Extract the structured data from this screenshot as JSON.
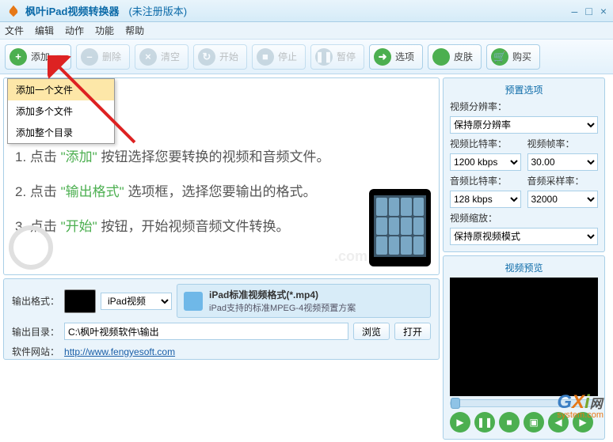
{
  "title": "枫叶iPad视频转换器",
  "subtitle": "(未注册版本)",
  "menus": [
    "文件",
    "编辑",
    "动作",
    "功能",
    "帮助"
  ],
  "toolbar": {
    "add": "添加",
    "delete": "删除",
    "clear": "清空",
    "start": "开始",
    "stop": "停止",
    "pause": "暂停",
    "options": "选项",
    "skin": "皮肤",
    "buy": "购买"
  },
  "add_menu": {
    "i1": "添加一个文件",
    "i2": "添加多个文件",
    "i3": "添加整个目录"
  },
  "instructions": {
    "l1a": "1. 点击",
    "l1b": "\"添加\"",
    "l1c": "按钮选择您要转换的视频和音频文件。",
    "l2a": "2. 点击",
    "l2b": "\"输出格式\"",
    "l2c": "选项框，选择您要输出的格式。",
    "l3a": "3. 点击",
    "l3b": "\"开始\"",
    "l3c": "按钮，开始视频音频文件转换。"
  },
  "watermark_text": ".com",
  "output": {
    "format_label": "输出格式：",
    "format_sel": "iPad视频",
    "format_title": "iPad标准视频格式(*.mp4)",
    "format_desc": "iPad支持的标准MPEG-4视频预置方案",
    "dir_label": "输出目录：",
    "dir_value": "C:\\枫叶视频软件\\输出",
    "browse": "浏览",
    "open": "打开",
    "site_label": "软件网站：",
    "site_url": "http://www.fengyesoft.com"
  },
  "preset": {
    "title": "预置选项",
    "res_label": "视频分辨率：",
    "res_value": "保持原分辨率",
    "vbit_label": "视频比特率：",
    "vbit_value": "1200 kbps",
    "vfps_label": "视频帧率：",
    "vfps_value": "30.00",
    "abit_label": "音频比特率：",
    "abit_value": "128 kbps",
    "asamp_label": "音频采样率：",
    "asamp_value": "32000",
    "zoom_label": "视频缩放：",
    "zoom_value": "保持原视频模式"
  },
  "preview": {
    "title": "视频预览"
  },
  "logo": {
    "g": "G",
    "x": "X",
    "i": "i",
    "net": "网",
    "sub": "system.com"
  }
}
